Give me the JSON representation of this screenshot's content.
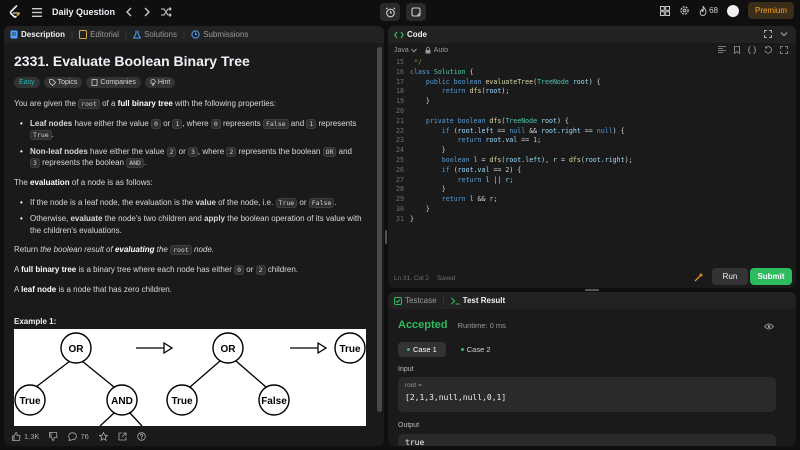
{
  "topbar": {
    "daily_label": "Daily Question",
    "streak_count": "68",
    "premium_label": "Premium"
  },
  "left": {
    "tabs": [
      "Description",
      "Editorial",
      "Solutions",
      "Submissions"
    ],
    "title": "2331. Evaluate Boolean Binary Tree",
    "chips": [
      "Easy",
      "Topics",
      "Companies",
      "Hint"
    ],
    "p1": {
      "a": "You are given the ",
      "code": "root",
      "b": " of a ",
      "bold": "full binary tree",
      "c": " with the following properties:"
    },
    "li1": {
      "bold": "Leaf nodes",
      "a": " have either the value ",
      "c1": "0",
      "b": " or ",
      "c2": "1",
      "c": ", where ",
      "c3": "0",
      "d": " represents ",
      "c4": "False",
      "e": " and ",
      "c5": "1",
      "f": " represents ",
      "c6": "True",
      "g": "."
    },
    "li2": {
      "bold": "Non-leaf nodes",
      "a": " have either the value ",
      "c1": "2",
      "b": " or ",
      "c2": "3",
      "c": ", where ",
      "c3": "2",
      "d": " represents the boolean ",
      "c4": "OR",
      "e": " and ",
      "c5": "3",
      "f": " represents the boolean ",
      "c6": "AND",
      "g": "."
    },
    "p2": {
      "a": "The ",
      "bold": "evaluation",
      "b": " of a node is as follows:"
    },
    "li3": {
      "a": "If the node is a leaf node, the evaluation is the ",
      "bold": "value",
      "b": " of the node, i.e. ",
      "c1": "True",
      "c": " or ",
      "c2": "False",
      "d": "."
    },
    "li4": {
      "a": "Otherwise, ",
      "bold1": "evaluate",
      "b": " the node's two children and ",
      "bold2": "apply",
      "c": " the boolean operation of its value with the children's evaluations."
    },
    "p3": {
      "a": "Return ",
      "it1": "the boolean result of ",
      "bi": "evaluating",
      "it2": " the ",
      "code": "root",
      "it3": " node."
    },
    "p4": {
      "a": "A ",
      "bold": "full binary tree",
      "b": " is a binary tree where each node has either ",
      "c1": "0",
      "c": " or ",
      "c2": "2",
      "d": " children."
    },
    "p5": {
      "a": "A ",
      "bold": "leaf node",
      "b": " is a node that has zero children."
    },
    "example_heading": "Example 1:",
    "tree": [
      "OR",
      "True",
      "AND",
      "OR",
      "True",
      "False",
      "True"
    ],
    "footer": {
      "likes": "1.3K",
      "comments": "76"
    }
  },
  "code": {
    "tab": "Code",
    "language": "Java",
    "auto": "Auto",
    "status_pos": "Ln 31, Col 2",
    "status_saved": "Saved",
    "run_label": "Run",
    "submit_label": "Submit"
  },
  "test": {
    "tabs": [
      "Testcase",
      "Test Result"
    ],
    "verdict": "Accepted",
    "runtime": "Runtime: 0 ms",
    "cases": [
      "Case 1",
      "Case 2"
    ],
    "input_label": "Input",
    "var_label": "root =",
    "input_value": "[2,1,3,null,null,0,1]",
    "output_label": "Output",
    "output_value": "true"
  },
  "colors": {
    "accent": "#ffa116",
    "success": "#2cbb5d",
    "easy": "#1cbaba"
  }
}
